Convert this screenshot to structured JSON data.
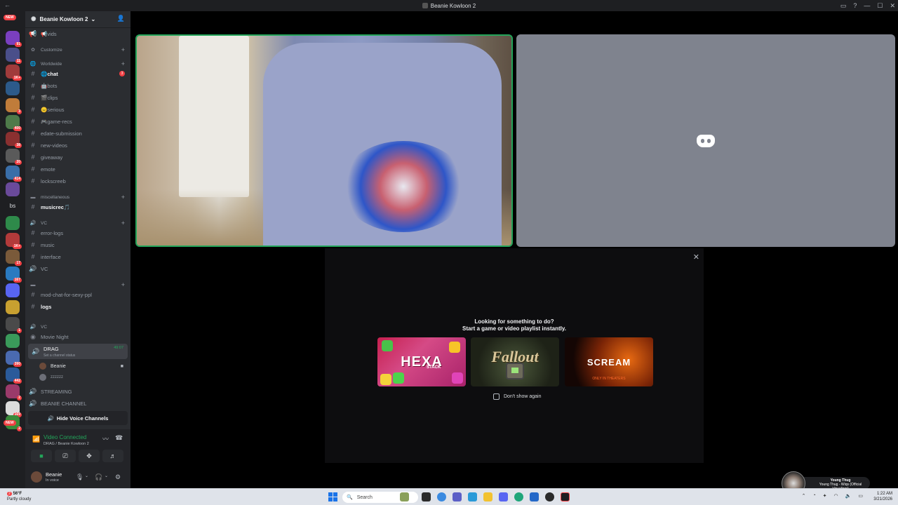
{
  "window": {
    "title": "Beanie Kowloon 2",
    "back": "←"
  },
  "rail": {
    "new_top": "NEW",
    "new_bottom": "NEW",
    "bs_label": "bs",
    "badges": [
      "91",
      "11",
      "",
      "1K+",
      "",
      "3",
      "400",
      "38",
      "20",
      "414",
      "",
      "",
      "",
      "1K+",
      "17",
      "167",
      "",
      "",
      "1",
      "390",
      "442",
      "2",
      "169",
      "2"
    ]
  },
  "server": {
    "name": "Beanie Kowloon 2",
    "chevron": "⌄"
  },
  "channels": {
    "vids": "📢vids",
    "customize": "Customize",
    "cat_worldwide": "Worldwide",
    "chat": "🌐chat",
    "chat_badge": "3",
    "bots": "🤖bots",
    "clips": "🎬clips",
    "serious": "😐serious",
    "game_recs": "🎮game-recs",
    "edate": "edate-submission",
    "new_videos": "new-videos",
    "giveaway": "giveaway",
    "emote": "emote",
    "lockscreeb": "lockscreeb",
    "cat_misc": "miscellaneous",
    "musicrec": "musicrec🎵",
    "cat_vc": "VC",
    "error_logs": "error-logs",
    "music": "music",
    "interface": "interface",
    "vc": "VC",
    "cat_unnamed": "",
    "mod_chat": "mod-chat-for-sexy-ppl",
    "logs": "logs",
    "cat_vc2": "VC",
    "movie_night": "Movie Night",
    "drag": "DRAG",
    "drag_time": "49:07",
    "drag_status": "Set a channel status",
    "user1": "Beanie",
    "user2": "zzzzzz",
    "streaming": "STREAMING",
    "beanie_channel": "BEANIE CHANNEL",
    "hide_voice": "Hide Voice Channels"
  },
  "voice": {
    "status": "Video Connected",
    "location": "DRAG / Beanie Kowloon 2"
  },
  "user": {
    "name": "Beanie",
    "status": "In voice"
  },
  "activity": {
    "line1": "Looking for something to do?",
    "line2": "Start a game or video playlist instantly.",
    "games": [
      {
        "title": "HEXA",
        "subtitle": "STACK"
      },
      {
        "title": "Fallout"
      },
      {
        "title": "SCREAM",
        "subtitle": "ONLY IN THEATERS"
      }
    ],
    "dont_show": "Don't show again"
  },
  "taskbar": {
    "temp": "56°F",
    "weather": "Partly cloudy",
    "weather_badge": "2",
    "search": "Search",
    "time": "1:22 AM",
    "date": "3/21/2026"
  },
  "now_playing": {
    "artist": "Young Thug",
    "title": "Young Thug - Wiqs (Official Visualizer)"
  },
  "colors": {
    "accent_green": "#23a55a",
    "alert_red": "#f23f43",
    "sidebar": "#2b2d31",
    "rail": "#1e1f22"
  }
}
